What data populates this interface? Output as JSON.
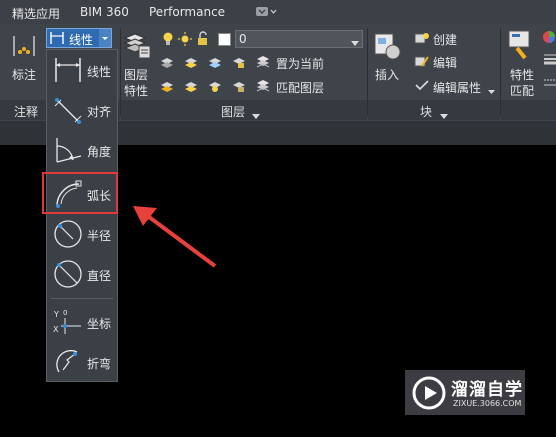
{
  "tabs": [
    "精选应用",
    "BIM 360",
    "Performance"
  ],
  "annotation_panel": {
    "label": "标注",
    "footer": "注释",
    "linear_button": "线性"
  },
  "layers_panel": {
    "layer_properties": "图层\n特性",
    "layer_properties_line1": "图层",
    "layer_properties_line2": "特性",
    "layer_name": "0",
    "set_current": "置为当前",
    "match_layer": "匹配图层",
    "footer": "图层"
  },
  "block_panel": {
    "insert": "插入",
    "create": "创建",
    "edit": "编辑",
    "edit_attributes": "编辑属性",
    "footer": "块"
  },
  "properties_panel": {
    "label_line1": "特性",
    "label_line2": "匹配"
  },
  "dimension_menu": {
    "items": [
      {
        "label": "线性",
        "icon": "linear-dimension-icon"
      },
      {
        "label": "对齐",
        "icon": "aligned-dimension-icon"
      },
      {
        "label": "角度",
        "icon": "angular-dimension-icon"
      },
      {
        "label": "弧长",
        "icon": "arc-length-dimension-icon"
      },
      {
        "label": "半径",
        "icon": "radius-dimension-icon"
      },
      {
        "label": "直径",
        "icon": "diameter-dimension-icon"
      },
      {
        "label": "坐标",
        "icon": "ordinate-dimension-icon"
      },
      {
        "label": "折弯",
        "icon": "jogged-dimension-icon"
      }
    ],
    "highlighted": "弧长"
  },
  "watermark": {
    "title": "溜溜自学",
    "url": "ZIXUE.3066.COM"
  },
  "colors": {
    "ribbon": "#3f444b",
    "canvas": "#000000",
    "highlight": "#e0393c",
    "selected": "#2e6ab0"
  }
}
